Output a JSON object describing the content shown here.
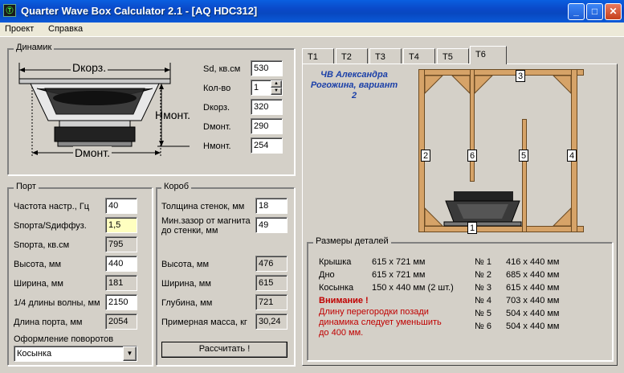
{
  "window": {
    "title": "Quarter Wave Box Calculator 2.1 - [AQ HDC312]",
    "icon_text": "Ⓣ",
    "buttons": {
      "minimize": "_",
      "maximize": "□",
      "close": "✕"
    }
  },
  "menu": {
    "items": [
      "Проект",
      "Справка"
    ]
  },
  "speaker": {
    "group_label": "Динамик",
    "diagram": {
      "dkorz_label": "Dкорз.",
      "dmont_label": "Dмонт.",
      "hmont_label": "Hмонт."
    },
    "fields": [
      {
        "label": "Sd, кв.см",
        "value": "530"
      },
      {
        "label": "Кол-во",
        "value": "1"
      },
      {
        "label": "Dкорз.",
        "value": "320"
      },
      {
        "label": "Dмонт.",
        "value": "290"
      },
      {
        "label": "Hмонт.",
        "value": "254"
      }
    ]
  },
  "port": {
    "group_label": "Порт",
    "fields": [
      {
        "label": "Частота настр., Гц",
        "value": "40"
      },
      {
        "label": "Sпорта/Sдиффуз.",
        "value": "1,5"
      },
      {
        "label": "Sпорта, кв.см",
        "value": "795"
      },
      {
        "label": "Высота, мм",
        "value": "440"
      },
      {
        "label": "Ширина, мм",
        "value": "181"
      },
      {
        "label": "1/4 длины волны, мм",
        "value": "2150"
      },
      {
        "label": "Длина порта, мм",
        "value": "2054"
      }
    ],
    "turn_label": "Оформление поворотов",
    "turn_value": "Косынка"
  },
  "box": {
    "group_label": "Короб",
    "fields": [
      {
        "label": "Толщина стенок, мм",
        "value": "18"
      },
      {
        "label": "Мин.зазор от магнита до стенки, мм",
        "value": "49"
      },
      {
        "label": "Высота, мм",
        "value": "476"
      },
      {
        "label": "Ширина, мм",
        "value": "615"
      },
      {
        "label": "Глубина, мм",
        "value": "721"
      },
      {
        "label": "Примерная масса, кг",
        "value": "30,24"
      }
    ],
    "calc_button": "Рассчитать !"
  },
  "tabs": {
    "items": [
      "T1",
      "T2",
      "T3",
      "T4",
      "T5",
      "T6"
    ],
    "active": "T6"
  },
  "design": {
    "title": "ЧВ Александра Рогожина, вариант 2",
    "part_numbers": [
      "1",
      "2",
      "3",
      "4",
      "5",
      "6"
    ]
  },
  "details": {
    "group_label": "Размеры деталей",
    "left": [
      {
        "name": "Крышка",
        "size": "615 x 721 мм"
      },
      {
        "name": "Дно",
        "size": "615 x 721 мм"
      },
      {
        "name": "Косынка",
        "size": "150 x 440 мм (2 шт.)"
      }
    ],
    "warning_title": "Внимание !",
    "warning_text": "Длину перегородки позади динамика следует уменьшить до 400 мм.",
    "right": [
      {
        "num": "№ 1",
        "size": "416 x 440 мм"
      },
      {
        "num": "№ 2",
        "size": "685 x 440 мм"
      },
      {
        "num": "№ 3",
        "size": "615 x 440 мм"
      },
      {
        "num": "№ 4",
        "size": "703 x 440 мм"
      },
      {
        "num": "№ 5",
        "size": "504 x 440 мм"
      },
      {
        "num": "№ 6",
        "size": "504 x 440 мм"
      }
    ]
  },
  "colors": {
    "title_bar": "#0a49c8",
    "wood": "#d6a368",
    "warning": "#c00000",
    "design_title": "#1a3fa8"
  }
}
